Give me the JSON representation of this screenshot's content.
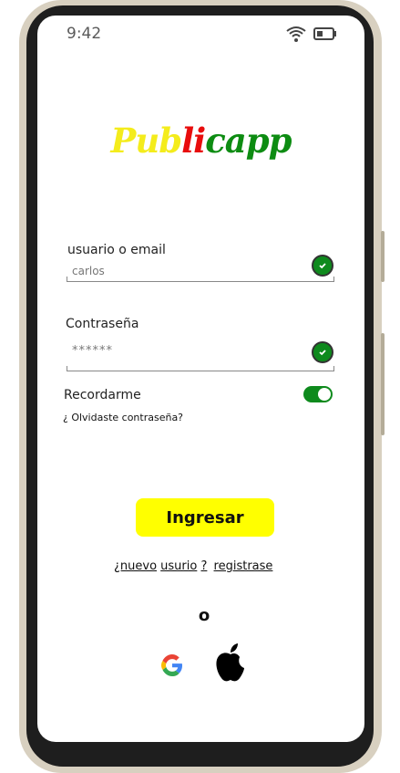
{
  "status_bar": {
    "time": "9:42"
  },
  "logo": {
    "part1": "Pub",
    "part2": "li",
    "part3": "capp"
  },
  "form": {
    "username_label": "usuario  o email",
    "username_value": "carlos",
    "password_label": "Contraseña",
    "password_value": "******",
    "remember_label": "Recordarme",
    "remember_on": true,
    "forgot_link": "¿ Olvidaste contraseña?"
  },
  "actions": {
    "login_label": "Ingresar",
    "new_part1": "¿nuevo",
    "new_part2": "usurio",
    "new_part3": "?",
    "register_link": "registrase",
    "or_label": "o"
  },
  "social": {
    "google": "google-icon",
    "apple": "apple-icon"
  },
  "colors": {
    "accent": "#ffff00",
    "green": "#0e8a1d",
    "red": "#e80c0c",
    "yellow": "#f4ec1c"
  }
}
